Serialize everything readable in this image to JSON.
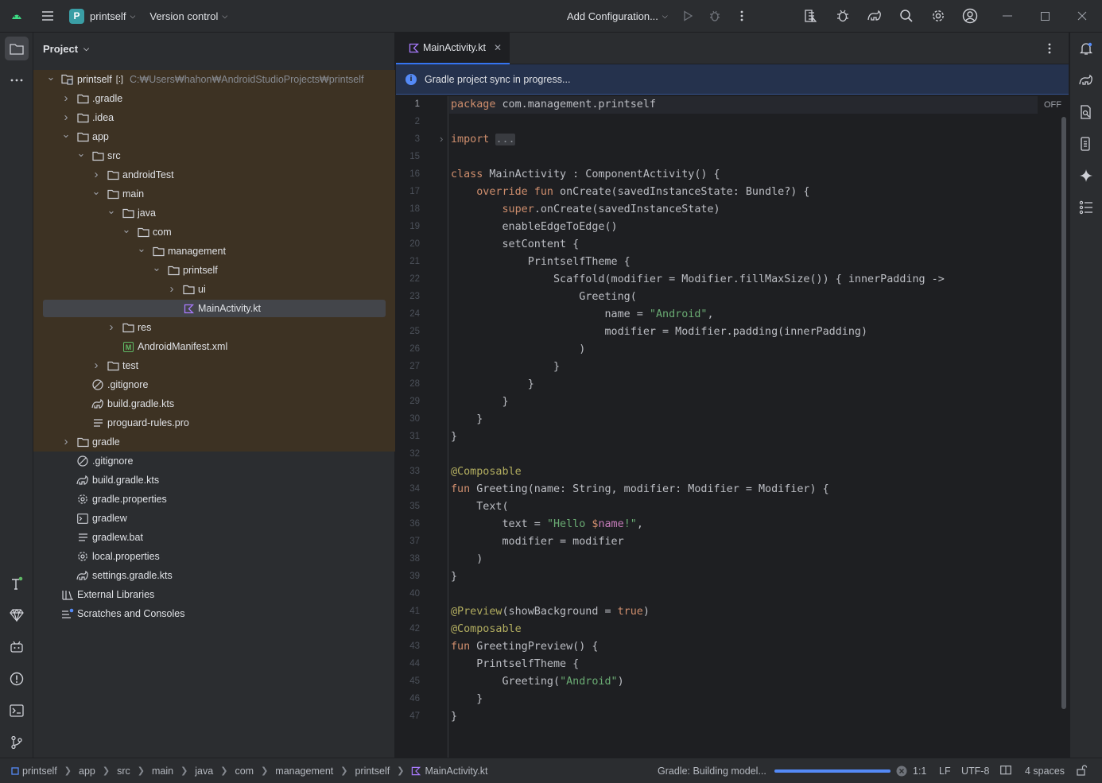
{
  "title_bar": {
    "project_name": "printself",
    "project_badge": "P",
    "vcs_label": "Version control",
    "run_config_label": "Add Configuration..."
  },
  "left_strip": {
    "icons": [
      "project-folder-icon",
      "more-icon",
      "build-variants-icon",
      "gemini-icon",
      "device-manager-icon",
      "problems-icon",
      "terminal-icon",
      "git-icon"
    ]
  },
  "project_panel": {
    "title": "Project",
    "tree": [
      {
        "depth": 0,
        "arrow": "open",
        "icon": "module",
        "label": "printself",
        "suffix": "[:]",
        "path": "C:₩Users₩hahon₩AndroidStudioProjects₩printself",
        "hl": true
      },
      {
        "depth": 1,
        "arrow": "closed",
        "icon": "folder",
        "label": ".gradle",
        "hl": true
      },
      {
        "depth": 1,
        "arrow": "closed",
        "icon": "folder",
        "label": ".idea",
        "hl": true
      },
      {
        "depth": 1,
        "arrow": "open",
        "icon": "folder",
        "label": "app",
        "hl": true
      },
      {
        "depth": 2,
        "arrow": "open",
        "icon": "folder",
        "label": "src",
        "hl": true
      },
      {
        "depth": 3,
        "arrow": "closed",
        "icon": "folder",
        "label": "androidTest",
        "hl": true
      },
      {
        "depth": 3,
        "arrow": "open",
        "icon": "folder",
        "label": "main",
        "hl": true
      },
      {
        "depth": 4,
        "arrow": "open",
        "icon": "folder",
        "label": "java",
        "hl": true
      },
      {
        "depth": 5,
        "arrow": "open",
        "icon": "folder",
        "label": "com",
        "hl": true
      },
      {
        "depth": 6,
        "arrow": "open",
        "icon": "folder",
        "label": "management",
        "hl": true
      },
      {
        "depth": 7,
        "arrow": "open",
        "icon": "folder",
        "label": "printself",
        "hl": true
      },
      {
        "depth": 8,
        "arrow": "closed",
        "icon": "folder",
        "label": "ui",
        "hl": true
      },
      {
        "depth": 8,
        "arrow": "none",
        "icon": "kotlin",
        "label": "MainActivity.kt",
        "hl": true,
        "selected": true
      },
      {
        "depth": 4,
        "arrow": "closed",
        "icon": "folder",
        "label": "res",
        "hl": true
      },
      {
        "depth": 4,
        "arrow": "none",
        "icon": "manifest",
        "label": "AndroidManifest.xml",
        "hl": true
      },
      {
        "depth": 3,
        "arrow": "closed",
        "icon": "folder",
        "label": "test",
        "hl": true
      },
      {
        "depth": 2,
        "arrow": "none",
        "icon": "ignore",
        "label": ".gitignore",
        "hl": true
      },
      {
        "depth": 2,
        "arrow": "none",
        "icon": "gradle",
        "label": "build.gradle.kts",
        "hl": true
      },
      {
        "depth": 2,
        "arrow": "none",
        "icon": "text",
        "label": "proguard-rules.pro",
        "hl": true
      },
      {
        "depth": 1,
        "arrow": "closed",
        "icon": "folder",
        "label": "gradle",
        "hl": true
      },
      {
        "depth": 1,
        "arrow": "none",
        "icon": "ignore",
        "label": ".gitignore"
      },
      {
        "depth": 1,
        "arrow": "none",
        "icon": "gradle",
        "label": "build.gradle.kts"
      },
      {
        "depth": 1,
        "arrow": "none",
        "icon": "settings",
        "label": "gradle.properties"
      },
      {
        "depth": 1,
        "arrow": "none",
        "icon": "script",
        "label": "gradlew"
      },
      {
        "depth": 1,
        "arrow": "none",
        "icon": "text",
        "label": "gradlew.bat"
      },
      {
        "depth": 1,
        "arrow": "none",
        "icon": "settings",
        "label": "local.properties"
      },
      {
        "depth": 1,
        "arrow": "none",
        "icon": "gradle",
        "label": "settings.gradle.kts"
      },
      {
        "depth": 0,
        "arrow": "none",
        "icon": "library",
        "label": "External Libraries"
      },
      {
        "depth": 0,
        "arrow": "none",
        "icon": "scratch",
        "label": "Scratches and Consoles"
      }
    ]
  },
  "editor": {
    "tab_label": "MainActivity.kt",
    "banner_text": "Gradle project sync in progress...",
    "inspection_label": "OFF",
    "lines": [
      {
        "n": "1",
        "cur": true,
        "html": "<span class=\"kw\">package</span> com.management.printself"
      },
      {
        "n": "2",
        "html": ""
      },
      {
        "n": "3",
        "fold": true,
        "html": "<span class=\"kw\">import</span> <span class=\"fold\">...</span>"
      },
      {
        "n": "15",
        "html": ""
      },
      {
        "n": "16",
        "html": "<span class=\"kw\">class</span> MainActivity : ComponentActivity() {"
      },
      {
        "n": "17",
        "html": "    <span class=\"kw\">override fun</span> onCreate(savedInstanceState: Bundle?) {"
      },
      {
        "n": "18",
        "html": "        <span class=\"kw\">super</span>.onCreate(savedInstanceState)"
      },
      {
        "n": "19",
        "html": "        enableEdgeToEdge()"
      },
      {
        "n": "20",
        "html": "        setContent {"
      },
      {
        "n": "21",
        "html": "            PrintselfTheme {"
      },
      {
        "n": "22",
        "html": "                Scaffold(modifier = Modifier.fillMaxSize()) { innerPadding ->"
      },
      {
        "n": "23",
        "html": "                    Greeting("
      },
      {
        "n": "24",
        "html": "                        name = <span class=\"str\">\"Android\"</span>,"
      },
      {
        "n": "25",
        "html": "                        modifier = Modifier.padding(innerPadding)"
      },
      {
        "n": "26",
        "html": "                    )"
      },
      {
        "n": "27",
        "html": "                }"
      },
      {
        "n": "28",
        "html": "            }"
      },
      {
        "n": "29",
        "html": "        }"
      },
      {
        "n": "30",
        "html": "    }"
      },
      {
        "n": "31",
        "html": "}"
      },
      {
        "n": "32",
        "html": ""
      },
      {
        "n": "33",
        "html": "<span class=\"ann\">@Composable</span>"
      },
      {
        "n": "34",
        "html": "<span class=\"kw\">fun</span> Greeting(name: String, modifier: Modifier = Modifier) {"
      },
      {
        "n": "35",
        "html": "    Text("
      },
      {
        "n": "36",
        "html": "        text = <span class=\"str\">\"Hello </span><span class=\"kw\">$</span><span class=\"var\">name</span><span class=\"str\">!\"</span>,"
      },
      {
        "n": "37",
        "html": "        modifier = modifier"
      },
      {
        "n": "38",
        "html": "    )"
      },
      {
        "n": "39",
        "html": "}"
      },
      {
        "n": "40",
        "html": ""
      },
      {
        "n": "41",
        "html": "<span class=\"ann\">@Preview</span>(showBackground = <span class=\"kw\">true</span>)"
      },
      {
        "n": "42",
        "html": "<span class=\"ann\">@Composable</span>"
      },
      {
        "n": "43",
        "html": "<span class=\"kw\">fun</span> GreetingPreview() {"
      },
      {
        "n": "44",
        "html": "    PrintselfTheme {"
      },
      {
        "n": "45",
        "html": "        Greeting(<span class=\"str\">\"Android\"</span>)"
      },
      {
        "n": "46",
        "html": "    }"
      },
      {
        "n": "47",
        "html": "}"
      }
    ]
  },
  "right_strip": {
    "icons": [
      "notifications-icon",
      "gradle-elephant-icon",
      "device-file-explorer-icon",
      "running-devices-icon",
      "ai-assistant-icon",
      "structure-icon"
    ]
  },
  "status_bar": {
    "breadcrumbs": [
      "printself",
      "app",
      "src",
      "main",
      "java",
      "com",
      "management",
      "printself",
      "MainActivity.kt"
    ],
    "task_text": "Gradle: Building model...",
    "progress": 1.0,
    "caret_position": "1:1",
    "line_separator": "LF",
    "encoding": "UTF-8",
    "indent": "4 spaces"
  },
  "colors": {
    "accent": "#3574f0",
    "highlight_row": "#3d3223",
    "panel_bg": "#2b2d30",
    "editor_bg": "#1e1f22"
  }
}
